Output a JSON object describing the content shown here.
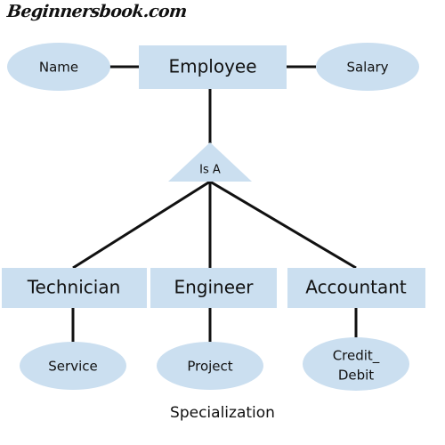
{
  "diagram": {
    "title": "Specialization",
    "watermark": "Beginnersbook.com",
    "type": "er-diagram-specialization",
    "colors": {
      "shape_fill": "#cbdff0",
      "line": "#111111",
      "text": "#111111",
      "background": "#ffffff"
    },
    "superclass": {
      "name": "Employee",
      "shape": "rectangle",
      "attributes": [
        {
          "name": "Name",
          "shape": "ellipse",
          "side": "left"
        },
        {
          "name": "Salary",
          "shape": "ellipse",
          "side": "right"
        }
      ]
    },
    "relationship": {
      "name": "Is A",
      "shape": "triangle"
    },
    "subclasses": [
      {
        "name": "Technician",
        "shape": "rectangle",
        "attribute": {
          "name": "Service",
          "shape": "ellipse"
        }
      },
      {
        "name": "Engineer",
        "shape": "rectangle",
        "attribute": {
          "name": "Project",
          "shape": "ellipse"
        }
      },
      {
        "name": "Accountant",
        "shape": "rectangle",
        "attribute": {
          "name_line1": "Credit_",
          "name_line2": "Debit",
          "shape": "ellipse"
        }
      }
    ],
    "caption": "Specialization"
  }
}
